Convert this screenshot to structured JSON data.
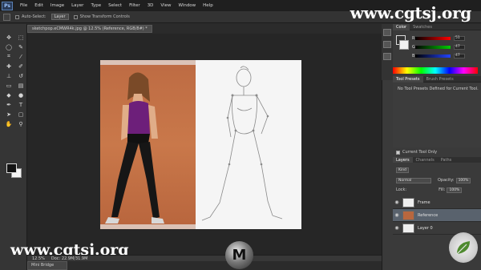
{
  "window": {
    "app_badge": "Ps",
    "menu": [
      "File",
      "Edit",
      "Image",
      "Layer",
      "Type",
      "Select",
      "Filter",
      "3D",
      "View",
      "Window",
      "Help"
    ]
  },
  "watermarks": {
    "top": "www.cgtsj.org",
    "bottom": "www.cgtsj.org"
  },
  "options_bar": {
    "auto_select_label": "Auto-Select:",
    "auto_select_value": "Layer",
    "show_transform_label": "Show Transform Controls"
  },
  "document_tab": {
    "title": "sketchpop.eCMWR4k.jpg @ 12.5% (Reference, RGB/8#) *"
  },
  "status_bar": {
    "zoom": "12.5%",
    "doc_info": "Doc: 22.9M/31.9M"
  },
  "mini_bridge": {
    "label": "Mini Bridge"
  },
  "color_panel": {
    "tabs": [
      "Color",
      "Swatches"
    ],
    "channels": [
      {
        "label": "R",
        "value": "51",
        "color": "#cc3333"
      },
      {
        "label": "G",
        "value": "47",
        "color": "#33aa33"
      },
      {
        "label": "B",
        "value": "47",
        "color": "#3355cc"
      }
    ]
  },
  "tool_presets_panel": {
    "tabs": [
      "Tool Presets",
      "Brush Presets"
    ],
    "message": "No Tool Presets Defined for Current Tool.",
    "current_tool_only_label": "Current Tool Only"
  },
  "layers_panel": {
    "tabs": [
      "Layers",
      "Channels",
      "Paths"
    ],
    "kind_label": "Kind",
    "blend_mode": "Normal",
    "opacity_label": "Opacity:",
    "opacity_value": "100%",
    "lock_label": "Lock:",
    "fill_label": "Fill:",
    "fill_value": "100%",
    "layers": [
      {
        "name": "Frame",
        "selected": false
      },
      {
        "name": "Reference",
        "selected": true
      },
      {
        "name": "Layer 0",
        "selected": false
      }
    ]
  }
}
